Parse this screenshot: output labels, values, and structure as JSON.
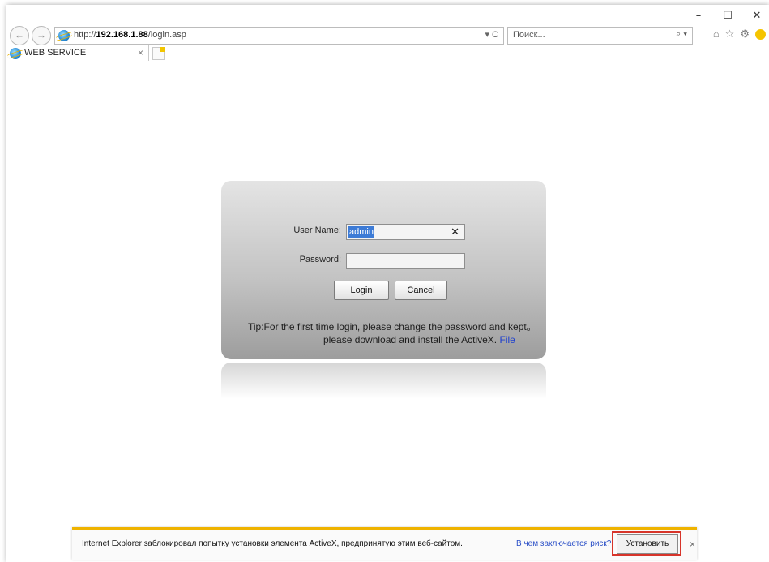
{
  "window": {
    "controls": {
      "minimize": "–",
      "maximize": "☐",
      "close": "✕"
    }
  },
  "nav": {
    "back": "←",
    "forward": "→"
  },
  "address": {
    "url_prefix": "http://",
    "url_host": "192.168.1.88",
    "url_path": "/login.asp",
    "tools": "▾ C"
  },
  "search": {
    "placeholder": "Поиск...",
    "icon": "⌕ ▾"
  },
  "toolbar_icons": [
    "home-icon",
    "star-icon",
    "gear-icon",
    "smiley-icon"
  ],
  "tab": {
    "title": "WEB SERVICE",
    "close": "×"
  },
  "login": {
    "username_label": "User Name:",
    "username_value": "admin",
    "clear": "✕",
    "password_label": "Password:",
    "login_button": "Login",
    "cancel_button": "Cancel",
    "tip_line1": "Tip:For the first time login, please change the password and kept。",
    "tip_line2": "please download and install the ActiveX.",
    "file_link": "File"
  },
  "notification": {
    "message": "Internet Explorer заблокировал попытку установки элемента ActiveX, предпринятую этим веб-сайтом.",
    "risk_link": "В чем заключается риск?",
    "install_button": "Установить",
    "close": "×"
  }
}
